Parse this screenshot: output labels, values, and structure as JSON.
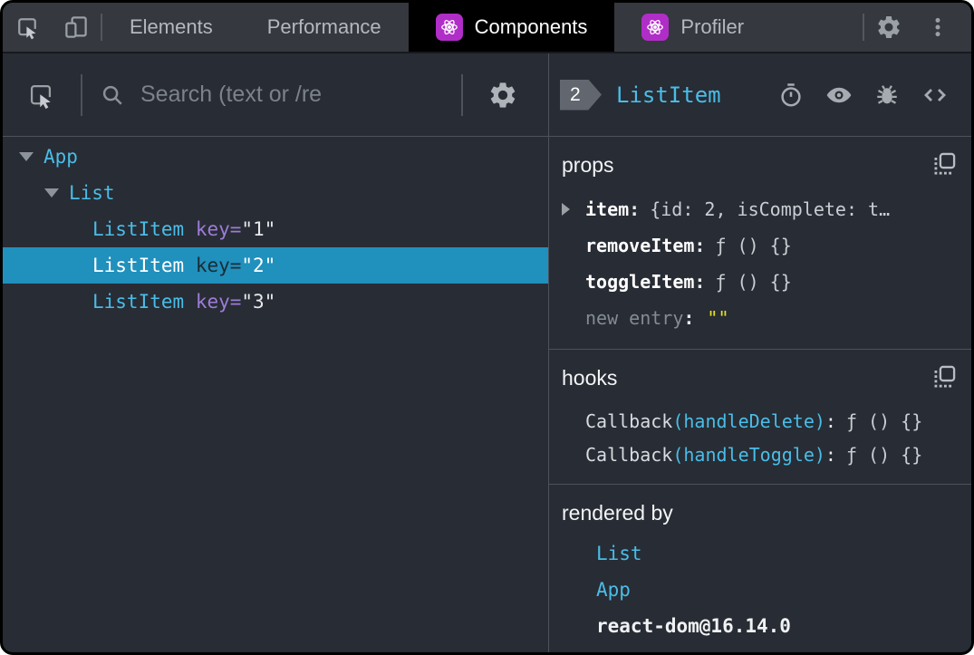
{
  "topbar": {
    "tabs": [
      {
        "label": "Elements"
      },
      {
        "label": "Performance"
      },
      {
        "label": "Components"
      },
      {
        "label": "Profiler"
      }
    ],
    "icons": [
      "inspect-icon",
      "device-toolbar-icon",
      "react-logo-icon",
      "settings-icon",
      "kebab-menu-icon"
    ]
  },
  "left_panel": {
    "toolbar_icons": [
      "inspect-icon",
      "search-icon",
      "settings-icon"
    ],
    "search": {
      "placeholder": "Search (text or /re"
    },
    "tree": [
      {
        "name": "App"
      },
      {
        "name": "List"
      },
      {
        "name": "ListItem",
        "attr": "key=",
        "value": "\"1\""
      },
      {
        "name": "ListItem",
        "attr": "key=",
        "value": "\"2\""
      },
      {
        "name": "ListItem",
        "attr": "key=",
        "value": "\"3\""
      }
    ]
  },
  "right_panel": {
    "header": {
      "badge": "2",
      "title": "ListItem",
      "icons": [
        "timer-icon",
        "eye-icon",
        "bug-icon",
        "view-source-icon"
      ]
    },
    "props": {
      "title": "props",
      "rows": [
        {
          "name": "item",
          "colon": ":",
          "value": "{id: 2, isComplete: t…"
        },
        {
          "name": "removeItem",
          "colon": ":",
          "value": "ƒ () {}"
        },
        {
          "name": "toggleItem",
          "colon": ":",
          "value": "ƒ () {}"
        },
        {
          "name": "new entry",
          "colon": ":",
          "value": "\"\""
        }
      ]
    },
    "hooks": {
      "title": "hooks",
      "rows": [
        {
          "fn": "Callback",
          "arg": "(handleDelete)",
          "colon": ":",
          "value": "ƒ () {}"
        },
        {
          "fn": "Callback",
          "arg": "(handleToggle)",
          "colon": ":",
          "value": "ƒ () {}"
        }
      ]
    },
    "rendered_by": {
      "title": "rendered by",
      "rows": [
        {
          "label": "List"
        },
        {
          "label": "App"
        },
        {
          "label": "react-dom@16.14.0"
        }
      ]
    }
  },
  "colors": {
    "panel_bg": "#282c34",
    "topbar_bg": "#35383e",
    "active_tab_bg": "#000000",
    "react_purple": "#b02ec7",
    "component_cyan": "#49bde8",
    "key_purple": "#9d7cd8",
    "selected_row_bg": "#2090bd",
    "new_entry_yellow": "#e8e41f",
    "icon_gray": "#9aa0a6"
  }
}
